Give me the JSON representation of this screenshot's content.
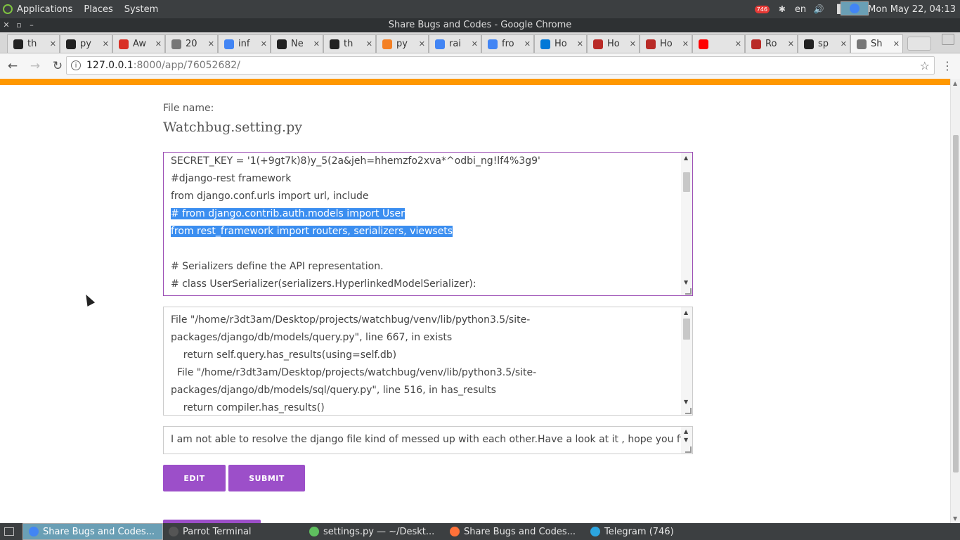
{
  "system_panel": {
    "menus": [
      "Applications",
      "Places",
      "System"
    ],
    "tray_badge": "746",
    "language": "en",
    "clock": "Mon May 22, 04:13"
  },
  "window": {
    "title": "Share Bugs and Codes - Google Chrome"
  },
  "tabs": [
    {
      "title": "th",
      "icon": "github-icon",
      "color": "#222222"
    },
    {
      "title": "py",
      "icon": "github-icon",
      "color": "#222222"
    },
    {
      "title": "Aw",
      "icon": "gmail-icon",
      "color": "#d93025"
    },
    {
      "title": "20",
      "icon": "document-icon",
      "color": "#777777"
    },
    {
      "title": "inf",
      "icon": "google-icon",
      "color": "#4285f4"
    },
    {
      "title": "Ne",
      "icon": "github-icon",
      "color": "#222222"
    },
    {
      "title": "th",
      "icon": "github-icon",
      "color": "#222222"
    },
    {
      "title": "py",
      "icon": "stackoverflow-icon",
      "color": "#f48024"
    },
    {
      "title": "rai",
      "icon": "google-icon",
      "color": "#4285f4"
    },
    {
      "title": "fro",
      "icon": "google-icon",
      "color": "#4285f4"
    },
    {
      "title": "Ho",
      "icon": "skype-icon",
      "color": "#0078d7"
    },
    {
      "title": "Ho",
      "icon": "quora-icon",
      "color": "#b92b27"
    },
    {
      "title": "Ho",
      "icon": "quora-icon",
      "color": "#b92b27"
    },
    {
      "title": "",
      "icon": "youtube-icon",
      "color": "#ff0000"
    },
    {
      "title": "Ro",
      "icon": "quora-icon",
      "color": "#b92b27"
    },
    {
      "title": "sp",
      "icon": "github-icon",
      "color": "#222222"
    },
    {
      "title": "Sh",
      "icon": "document-icon",
      "color": "#777777",
      "active": true
    }
  ],
  "address_bar": {
    "host": "127.0.0.1",
    "path": ":8000/app/76052682/"
  },
  "page": {
    "file_name_label": "File name:",
    "file_name": "Watchbug.setting.py",
    "code_lines": [
      {
        "text": "SECRET_KEY = '1(+9gt7k)8)y_5(2a&jeh=hhemzfo2xva*^odbi_ng!lf4%3g9'",
        "selected": false
      },
      {
        "text": "#django-rest framework",
        "selected": false
      },
      {
        "text": "from django.conf.urls import url, include",
        "selected": false
      },
      {
        "text": "# from django.contrib.auth.models import User ",
        "selected": true
      },
      {
        "text": "from rest_framework import routers, serializers, viewsets",
        "selected": true
      },
      {
        "text": "",
        "selected": false
      },
      {
        "text": "# Serializers define the API representation.",
        "selected": false
      },
      {
        "text": "# class UserSerializer(serializers.HyperlinkedModelSerializer):",
        "selected": false
      }
    ],
    "error_lines": [
      "File \"/home/r3dt3am/Desktop/projects/watchbug/venv/lib/python3.5/site-",
      "packages/django/db/models/query.py\", line 667, in exists",
      "    return self.query.has_results(using=self.db)",
      "  File \"/home/r3dt3am/Desktop/projects/watchbug/venv/lib/python3.5/site-",
      "packages/django/db/models/sql/query.py\", line 516, in has_results",
      "    return compiler.has_results()"
    ],
    "description": "I am not able to resolve the django file kind of messed up with each other.Have a look at it , hope you find",
    "edit_label": "EDIT",
    "submit_label": "SUBMIT"
  },
  "taskbar": {
    "items": [
      {
        "label": "Share Bugs and Codes...",
        "color": "#4285f4",
        "active": true
      },
      {
        "label": "Parrot Terminal",
        "color": "#555555",
        "active": false
      },
      {
        "label": "settings.py — ~/Deskt...",
        "color": "#5fbf5f",
        "active": false
      },
      {
        "label": "Share Bugs and Codes...",
        "color": "#ff7139",
        "active": false
      },
      {
        "label": "Telegram (746)",
        "color": "#2ca5e0",
        "active": false
      }
    ]
  }
}
